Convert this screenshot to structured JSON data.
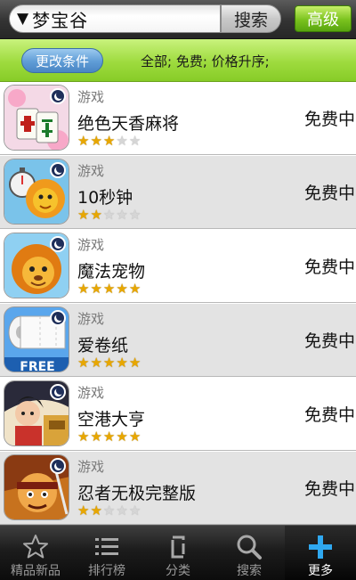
{
  "topbar": {
    "search_value": "梦宝谷",
    "dropdown_glyph": "▼",
    "search_button": "搜索",
    "advanced_button": "高级"
  },
  "filterbar": {
    "change_button": "更改条件",
    "summary": "全部;  免费;  价格升序;"
  },
  "apps": [
    {
      "category": "游戏",
      "name": "绝色天香麻将",
      "price": "免费中",
      "rating": 3,
      "icon": "mahjong-app-icon"
    },
    {
      "category": "游戏",
      "name": "10秒钟",
      "price": "免费中",
      "rating": 2,
      "icon": "stopwatch-lion-app-icon"
    },
    {
      "category": "游戏",
      "name": "魔法宠物",
      "price": "免费中",
      "rating": 5,
      "icon": "lion-pet-app-icon"
    },
    {
      "category": "游戏",
      "name": "爱卷纸",
      "price": "免费中",
      "rating": 5,
      "icon": "toilet-paper-app-icon",
      "icon_badge": "FREE"
    },
    {
      "category": "游戏",
      "name": "空港大亨",
      "price": "免费中",
      "rating": 5,
      "icon": "airport-tycoon-app-icon"
    },
    {
      "category": "游戏",
      "name": "忍者无极完整版",
      "price": "免费中",
      "rating": 2,
      "icon": "ninja-app-icon"
    }
  ],
  "bottomnav": [
    {
      "label": "精品新品",
      "icon": "star-icon"
    },
    {
      "label": "排行榜",
      "icon": "list-icon"
    },
    {
      "label": "分类",
      "icon": "category-icon"
    },
    {
      "label": "搜索",
      "icon": "search-icon"
    },
    {
      "label": "更多",
      "icon": "plus-icon",
      "active": true
    }
  ],
  "colors": {
    "accent_green": "#9edb3e",
    "star_on": "#e8a700",
    "plus_blue": "#2fa8f0"
  }
}
